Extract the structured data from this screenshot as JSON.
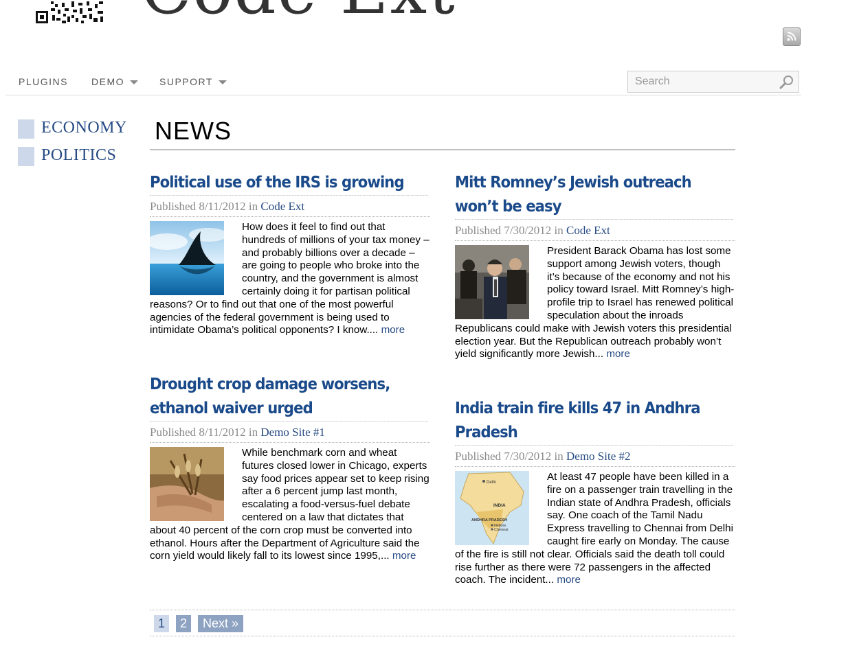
{
  "header": {
    "logo_text": "Code Ext",
    "rss_icon": "rss-icon"
  },
  "nav": {
    "items": [
      {
        "label": "PLUGINS",
        "has_dropdown": false
      },
      {
        "label": "DEMO",
        "has_dropdown": true
      },
      {
        "label": "SUPPORT",
        "has_dropdown": true
      }
    ]
  },
  "search": {
    "placeholder": "Search",
    "icon": "search-icon"
  },
  "sidebar": {
    "items": [
      {
        "label": "ECONOMY"
      },
      {
        "label": "POLITICS"
      }
    ]
  },
  "main": {
    "title": "NEWS",
    "articles": [
      {
        "title": "Political use of the IRS is growing",
        "published_label": "Published",
        "date": "8/11/2012",
        "in_label": "in",
        "site": "Code Ext",
        "thumb_icon": "shark-fin-image",
        "excerpt": "How does it feel to find out that hundreds of millions of your tax money – and probably billions over a  decade – are going to people who broke into the country, and the government is almost certainly doing it for partisan political reasons? Or to find out that one of the most powerful agencies of the federal government is being used to intimidate Obama’s political opponents? I know.... ",
        "more": "more"
      },
      {
        "title": "Mitt Romney’s Jewish outreach won’t be easy",
        "published_label": "Published",
        "date": "7/30/2012",
        "in_label": "in",
        "site": "Code Ext",
        "thumb_icon": "romney-photo-image",
        "excerpt": "President Barack Obama has lost some support among Jewish voters, though it’s because of the economy and not his policy toward Israel. Mitt Romney’s high-profile trip to Israel has renewed political speculation about the inroads Republicans could make with Jewish voters this presidential election year. But the Republican outreach probably won’t yield significantly more Jewish... ",
        "more": "more"
      },
      {
        "title": "Drought crop damage worsens, ethanol waiver urged",
        "published_label": "Published",
        "date": "8/11/2012",
        "in_label": "in",
        "site": "Demo Site #1",
        "thumb_icon": "wheat-hand-image",
        "excerpt": "While benchmark corn and wheat futures closed lower in Chicago, experts say food prices appear set to keep rising after a 6 percent jump last month, escalating a food-versus-fuel debate centered on a law that dictates that about 40 percent of the corn crop must be converted into ethanol. Hours after the Department of Agriculture said the corn yield would likely fall to its lowest since 1995,... ",
        "more": "more"
      },
      {
        "title": "India train fire kills 47 in Andhra Pradesh",
        "published_label": "Published",
        "date": "7/30/2012",
        "in_label": "in",
        "site": "Demo Site #2",
        "thumb_icon": "india-map-image",
        "map_labels": {
          "delhi": "Delhi",
          "india": "INDIA",
          "state": "ANDHRA PRADESH",
          "nellore": "Nellore",
          "chennai": "Chennai"
        },
        "excerpt": "At least 47 people have been killed in a fire on a passenger train travelling in the Indian state of Andhra Pradesh, officials say. One coach of the Tamil Nadu Express travelling to Chennai from Delhi caught fire early on Monday. The cause of the fire is still not clear. Officials said the death toll could rise further as there were 72 passengers in the affected coach. The incident... ",
        "more": "more"
      }
    ]
  },
  "pagination": {
    "pages": [
      "1",
      "2"
    ],
    "current": "1",
    "next": "Next »"
  },
  "colors": {
    "link": "#264b84",
    "title": "#1a4a8a",
    "sidebar_square": "#cdd9ea",
    "page_other": "#8ea2c2"
  }
}
